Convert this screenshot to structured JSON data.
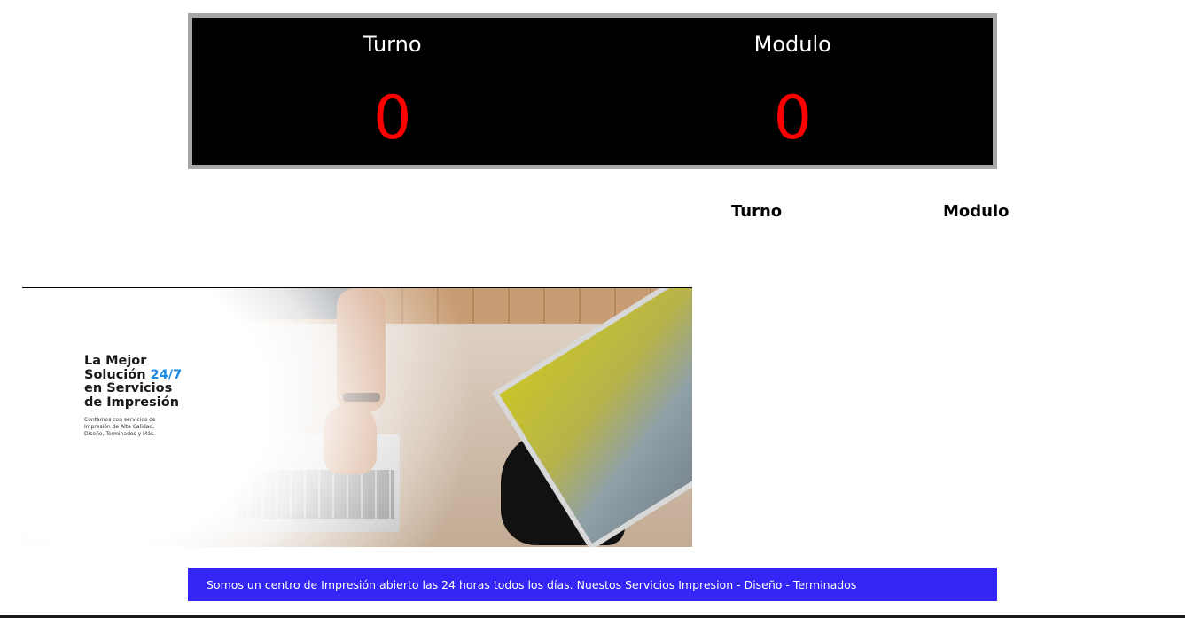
{
  "display_board": {
    "turno_label": "Turno",
    "modulo_label": "Modulo",
    "turno_value": "0",
    "modulo_value": "0",
    "value_color": "#ff0000",
    "background_color": "#000000",
    "border_color": "#a6a6a6"
  },
  "history_table": {
    "columns": [
      "Turno",
      "Modulo"
    ]
  },
  "hero_banner": {
    "title_line1": "La Mejor",
    "title_line2_prefix": "Solución ",
    "title_line2_accent": "24/7",
    "title_line3": "en Servicios",
    "title_line4": "de Impresión",
    "subtitle_line1": "Contamos con servicios de",
    "subtitle_line2": "Impresión de Alta Calidad,",
    "subtitle_line3": "Diseño, Terminados y Más.",
    "accent_color": "#1d8be8"
  },
  "footer_banner": {
    "text": "Somos un centro de Impresión abierto las 24 horas todos los días. Nuestos Servicios Impresion - Diseño - Terminados",
    "background_color": "#3426f7"
  }
}
